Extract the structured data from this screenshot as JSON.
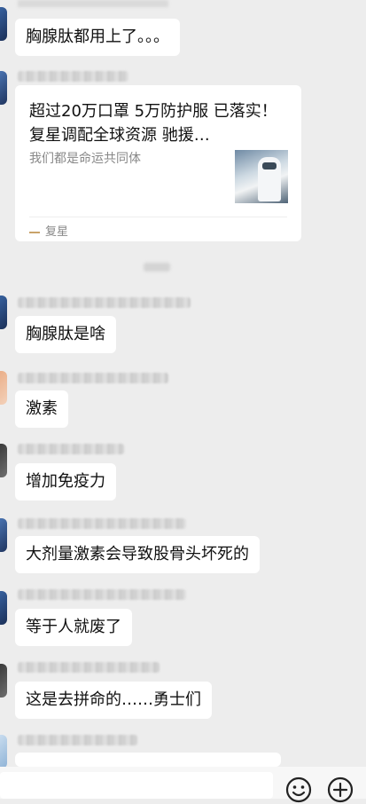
{
  "messages": {
    "m1": "胸腺肽都用上了。。。",
    "m2": "胸腺肽是啥",
    "m3": "激素",
    "m4": "增加免疫力",
    "m5": "大剂量激素会导致股骨头坏死的",
    "m6": "等于人就废了",
    "m7": "这是去拼命的……勇士们"
  },
  "card": {
    "title": "超过20万口罩 5万防护服 已落实！复星调配全球资源 驰援…",
    "desc": "我们都是命运共同体",
    "source": "复星"
  },
  "icons": {
    "emoji": "emoji-icon",
    "plus": "plus-icon"
  }
}
